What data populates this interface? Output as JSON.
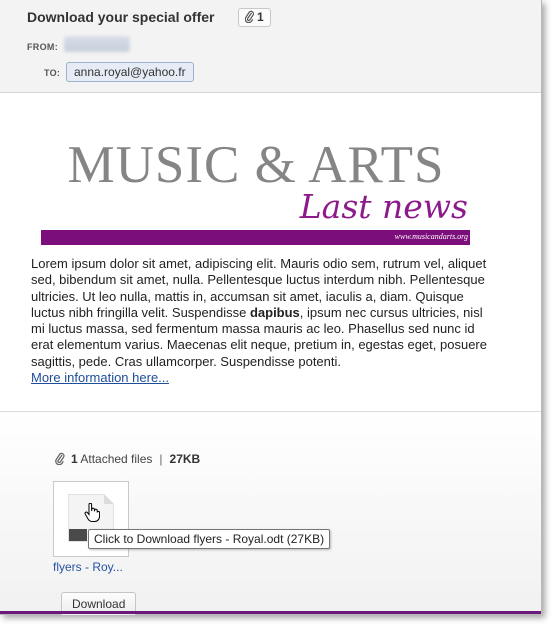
{
  "header": {
    "subject": "Download your special offer",
    "attachment_count": "1",
    "from_label": "FROM:",
    "to_label": "TO:",
    "to_value": "anna.royal@yahoo.fr"
  },
  "banner": {
    "title": "MUSIC & ARTS",
    "script": "Last news",
    "url": "www.musicandarts.org"
  },
  "body": {
    "p1": "Lorem ipsum dolor sit amet, adipiscing elit. Mauris odio sem, rutrum vel, aliquet sed, bibendum sit amet, nulla. Pellentesque luctus interdum nibh. Pellentesque ultricies. Ut leo nulla, mattis in, accumsan sit amet, iaculis a, diam. Quisque luctus nibh fringilla velit. Suspendisse ",
    "bold": "dapibus",
    "p2": ", ipsum nec cursus ultricies, nisl mi luctus massa, sed fermentum massa mauris ac leo. Phasellus sed nunc id erat elementum varius. Maecenas elit neque, pretium in, egestas eget, posuere sagittis, pede. Cras ullamcorper. Suspendisse potenti.",
    "link": "More information here..."
  },
  "attachments": {
    "count": "1",
    "label": "Attached files",
    "size": "27KB",
    "file_name": "flyers - Roy...",
    "tooltip": "Click to Download flyers - Royal.odt (27KB)",
    "download_label": "Download"
  },
  "icons": {
    "paperclip": "paperclip-icon",
    "cursor": "hand-cursor-icon"
  },
  "colors": {
    "brand_purple": "#7b0e7a",
    "link": "#1e4e9a"
  }
}
